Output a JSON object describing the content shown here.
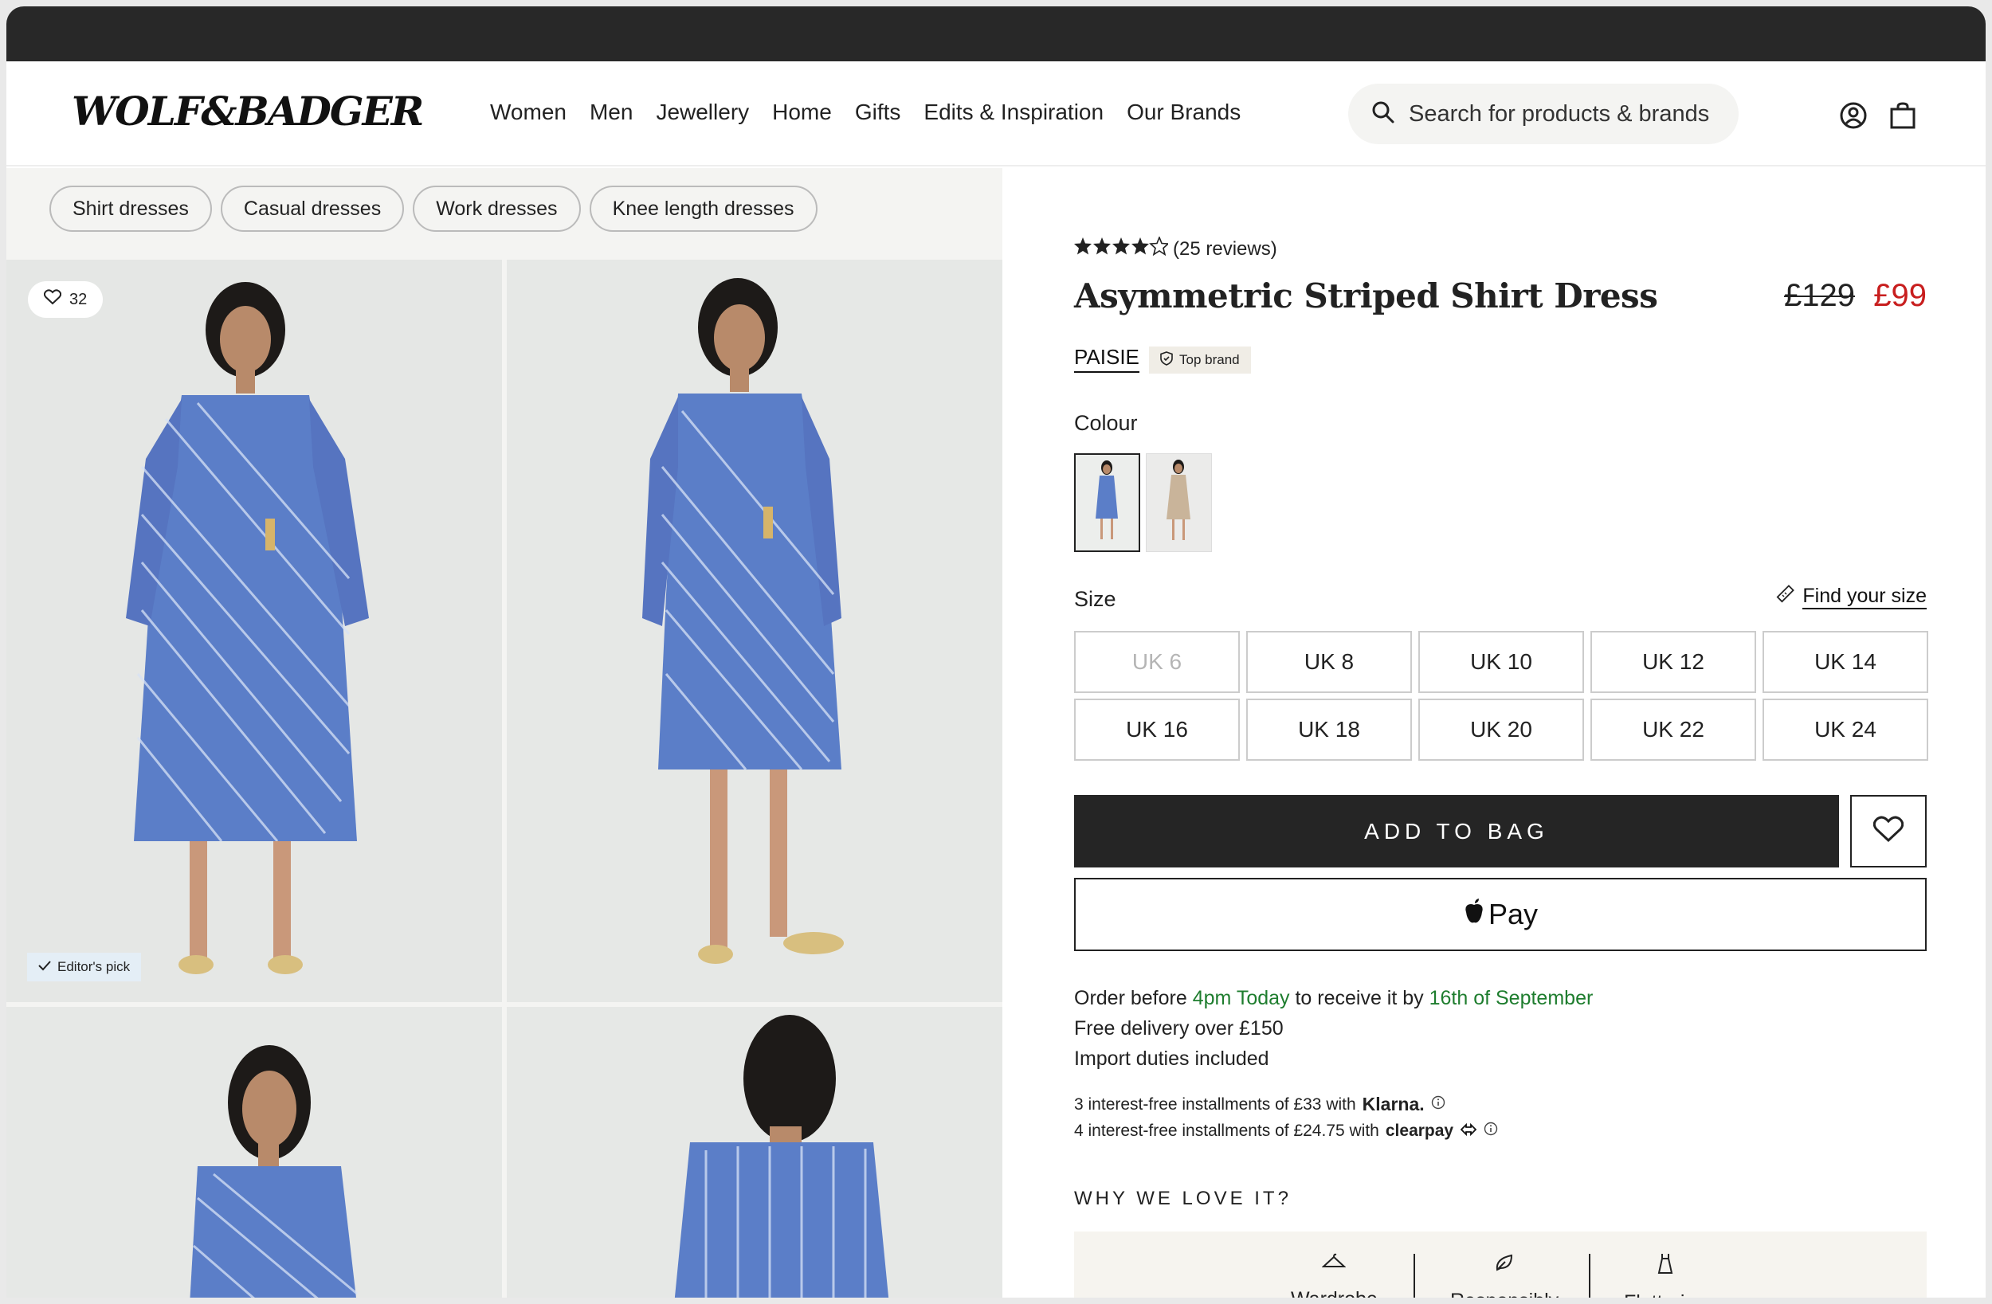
{
  "header": {
    "logo": "WOLF&BADGER",
    "nav": [
      "Women",
      "Men",
      "Jewellery",
      "Home",
      "Gifts",
      "Edits & Inspiration",
      "Our Brands"
    ],
    "search_placeholder": "Search for products & brands"
  },
  "chips": [
    "Shirt dresses",
    "Casual dresses",
    "Work dresses",
    "Knee length dresses"
  ],
  "gallery": {
    "favourites_count": "32",
    "editors_pick": "Editor's pick"
  },
  "product": {
    "rating": 4,
    "reviews": "(25 reviews)",
    "title": "Asymmetric Striped Shirt Dress",
    "price_old": "£129",
    "price_new": "£99",
    "brand": "PAISIE",
    "brand_badge": "Top brand",
    "colour_label": "Colour",
    "colours": [
      "blue stripe",
      "beige"
    ],
    "size_label": "Size",
    "find_size": "Find your size",
    "sizes": [
      {
        "label": "UK 6",
        "available": false
      },
      {
        "label": "UK 8",
        "available": true
      },
      {
        "label": "UK 10",
        "available": true
      },
      {
        "label": "UK 12",
        "available": true
      },
      {
        "label": "UK 14",
        "available": true
      },
      {
        "label": "UK 16",
        "available": true
      },
      {
        "label": "UK 18",
        "available": true
      },
      {
        "label": "UK 20",
        "available": true
      },
      {
        "label": "UK 22",
        "available": true
      },
      {
        "label": "UK 24",
        "available": true
      }
    ],
    "add_to_bag": "ADD TO BAG",
    "apple_pay": "Pay"
  },
  "delivery": {
    "line1_a": "Order before ",
    "line1_time": "4pm Today",
    "line1_b": " to receive it by ",
    "line1_date": "16th of September",
    "line2": "Free delivery over £150",
    "line3": "Import duties included"
  },
  "installments": {
    "klarna_text": "3 interest-free installments of £33 with",
    "klarna_brand": "Klarna.",
    "clearpay_text": "4 interest-free installments of £24.75 with",
    "clearpay_brand": "clearpay"
  },
  "why": {
    "heading": "WHY WE LOVE IT?",
    "features": [
      "Wardrobe",
      "Responsibly",
      "Flattering"
    ]
  },
  "colors": {
    "accent_green": "#1e7d2e",
    "sale_red": "#c81e1e",
    "dress_blue": "#5b7ec8"
  }
}
